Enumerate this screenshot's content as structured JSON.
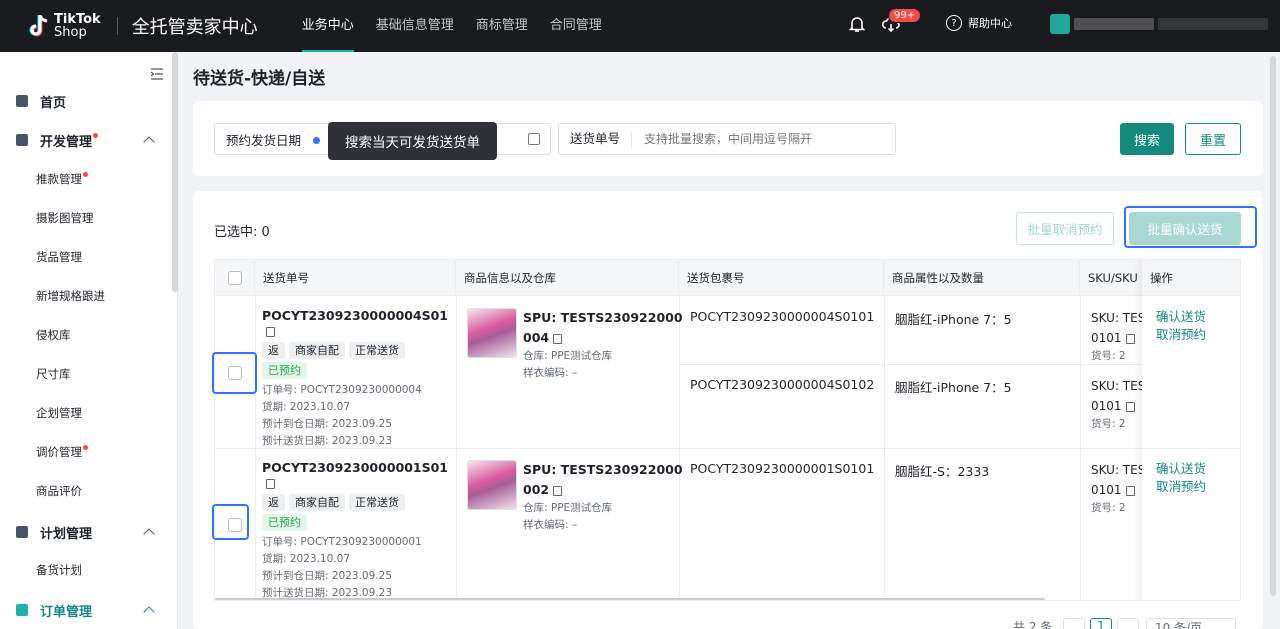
{
  "topbar": {
    "brand_line1": "TikTok",
    "brand_line2": "Shop",
    "center_title": "全托管卖家中心",
    "nav": [
      "业务中心",
      "基础信息管理",
      "商标管理",
      "合同管理"
    ],
    "badge": "99+",
    "help_label": "帮助中心"
  },
  "sidebar": {
    "home": "首页",
    "dev": "开发管理",
    "dev_items": [
      "推款管理",
      "摄影图管理",
      "货品管理",
      "新增规格跟进",
      "侵权库",
      "尺寸库",
      "企划管理",
      "调价管理",
      "商品评价"
    ],
    "plan": "计划管理",
    "plan_items": [
      "备货计划"
    ],
    "order": "订单管理"
  },
  "page": {
    "title": "待送货-快递/自送"
  },
  "filters": {
    "date_label": "预约发货日期",
    "tooltip": "搜索当天可发货送货单",
    "tracking_label": "送货单号",
    "tracking_placeholder": "支持批量搜索，中间用逗号隔开",
    "search_btn": "搜索",
    "reset_btn": "重置"
  },
  "table": {
    "selected": "已选中: 0",
    "batch_cancel": "批量取消预约",
    "batch_confirm": "批量确认送货",
    "headers": [
      "送货单号",
      "商品信息以及仓库",
      "送货包裹号",
      "商品属性以及数量",
      "SKU/SKU",
      "操作"
    ],
    "rows": [
      {
        "order_no": "POCYT2309230000004S01",
        "tags": [
          "返",
          "商家自配",
          "正常送货"
        ],
        "status": "已预约",
        "meta": [
          "订单号: POCYT2309230000004",
          "货期: 2023.10.07",
          "预计到仓日期: 2023.09.25",
          "预计送货日期: 2023.09.23"
        ],
        "spu_line1": "SPU: TESTS230922000",
        "spu_line2": "004",
        "warehouse": "仓库: PPE测试仓库",
        "sample": "样衣编码: –",
        "packages": [
          {
            "pkg": "POCYT2309230000004S0101",
            "attr": "胭脂红-iPhone 7：5",
            "sku1": "SKU: TES",
            "sku2": "0101",
            "sku3": "货号: 2"
          },
          {
            "pkg": "POCYT2309230000004S0102",
            "attr": "胭脂红-iPhone 7：5",
            "sku1": "SKU: TES",
            "sku2": "0101",
            "sku3": "货号: 2"
          }
        ],
        "ops": [
          "确认送货",
          "取消预约"
        ]
      },
      {
        "order_no": "POCYT2309230000001S01",
        "tags": [
          "返",
          "商家自配",
          "正常送货"
        ],
        "status": "已预约",
        "meta": [
          "订单号: POCYT2309230000001",
          "货期: 2023.10.07",
          "预计到仓日期: 2023.09.25",
          "预计送货日期: 2023.09.23"
        ],
        "spu_line1": "SPU: TESTS230922000",
        "spu_line2": "002",
        "warehouse": "仓库: PPE测试仓库",
        "sample": "样衣编码: –",
        "packages": [
          {
            "pkg": "POCYT2309230000001S0101",
            "attr": "胭脂红-S：2333",
            "sku1": "SKU: TES",
            "sku2": "0101",
            "sku3": "货号: 2"
          }
        ],
        "ops": [
          "确认送货",
          "取消预约"
        ]
      }
    ],
    "pager_total": "共 2 条",
    "pager_page": "1",
    "pager_size": "10 条/页"
  }
}
